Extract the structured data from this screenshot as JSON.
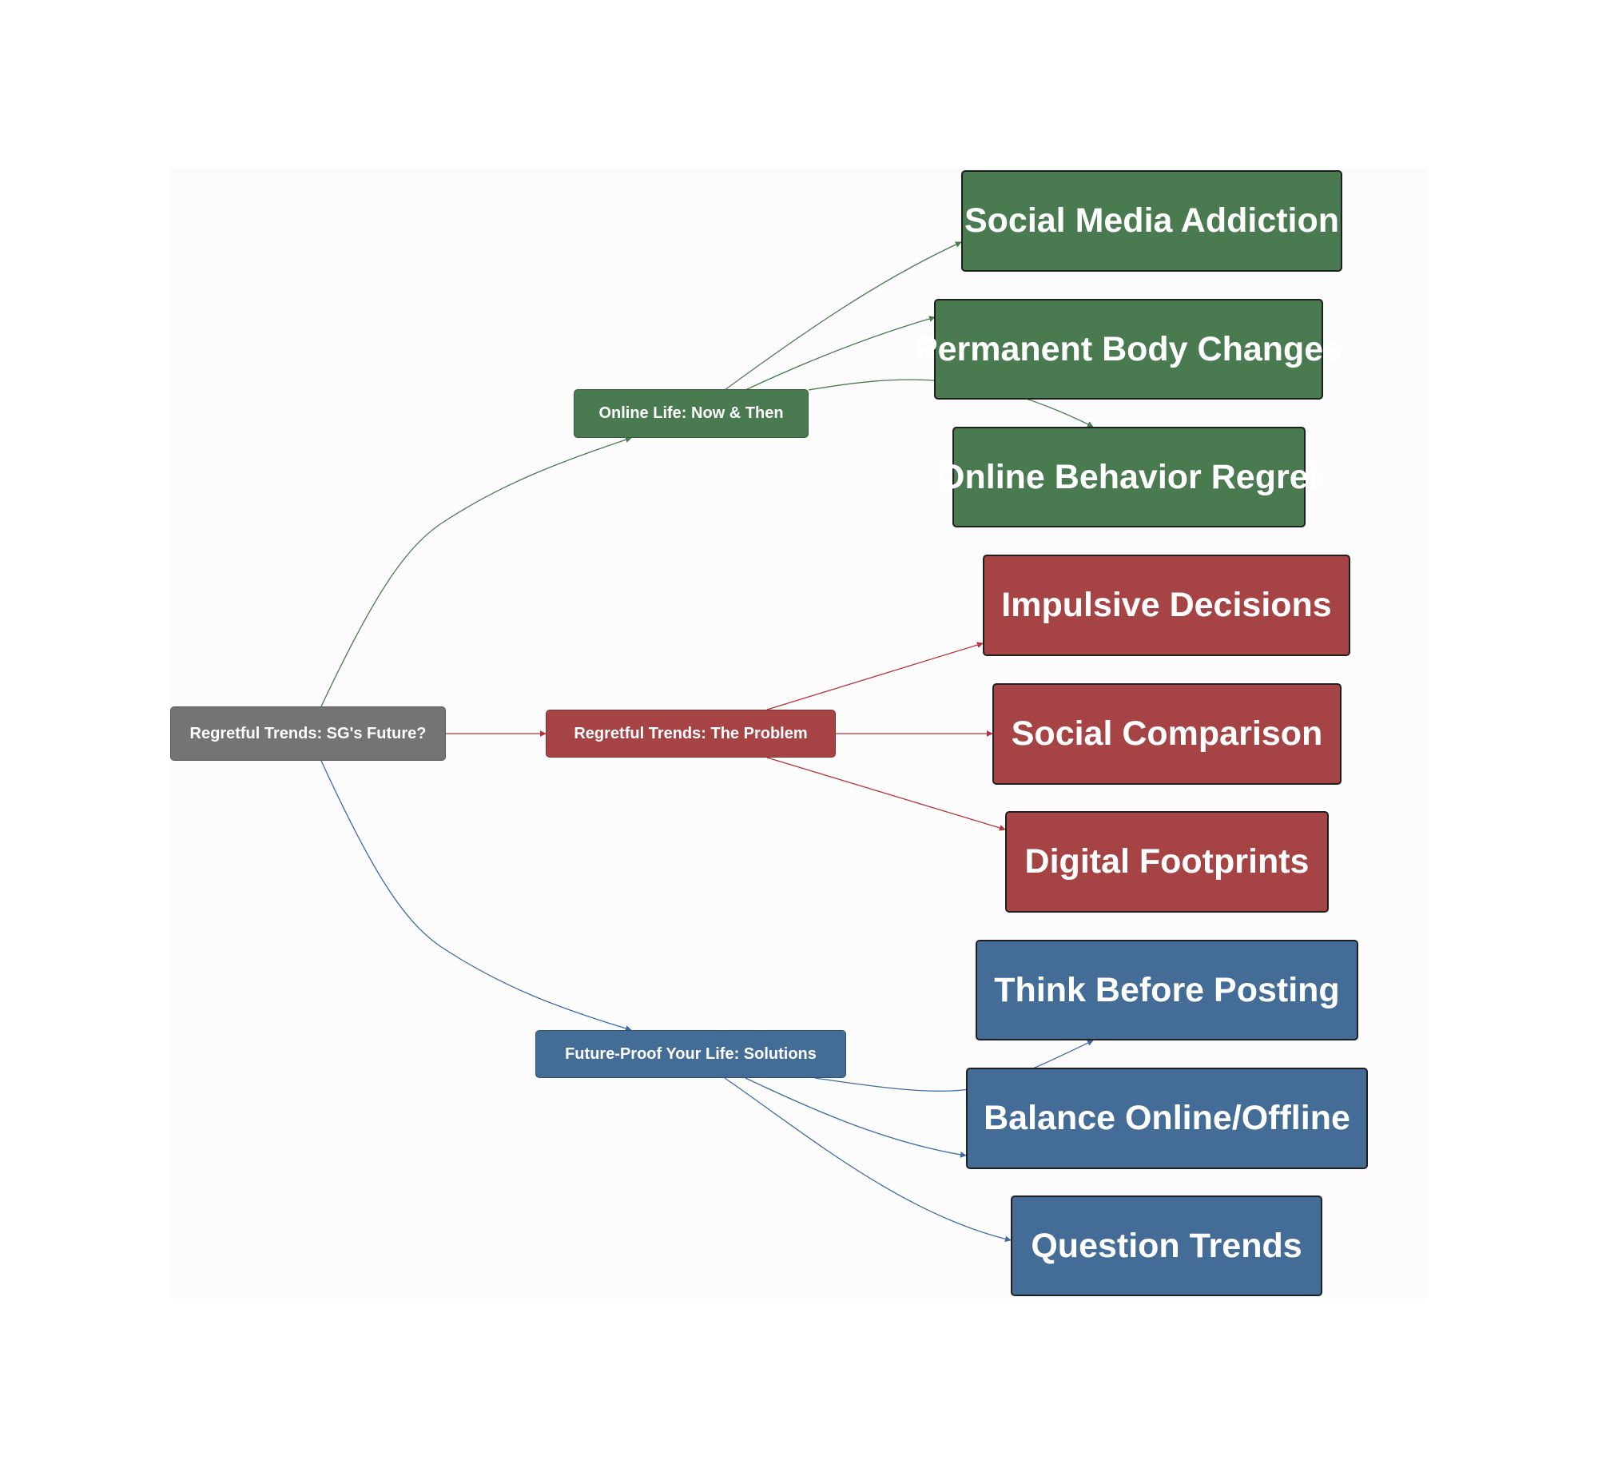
{
  "colors": {
    "root": "#737473",
    "online_life": "#4a7a4f",
    "problem": "#a64345",
    "solutions": "#436c96",
    "edge_green": "#4a7a4f",
    "edge_red": "#b7343a",
    "edge_blue": "#3e6aa6"
  },
  "root": {
    "label": "Regretful Trends: SG's Future?"
  },
  "branches": [
    {
      "label": "Online Life: Now & Then",
      "children": [
        "Social Media Addiction",
        "Permanent Body Changes",
        "Online Behavior Regret"
      ]
    },
    {
      "label": "Regretful Trends: The Problem",
      "children": [
        "Impulsive Decisions",
        "Social Comparison",
        "Digital Footprints"
      ]
    },
    {
      "label": "Future-Proof Your Life: Solutions",
      "children": [
        "Think Before Posting",
        "Balance Online/Offline",
        "Question Trends"
      ]
    }
  ]
}
